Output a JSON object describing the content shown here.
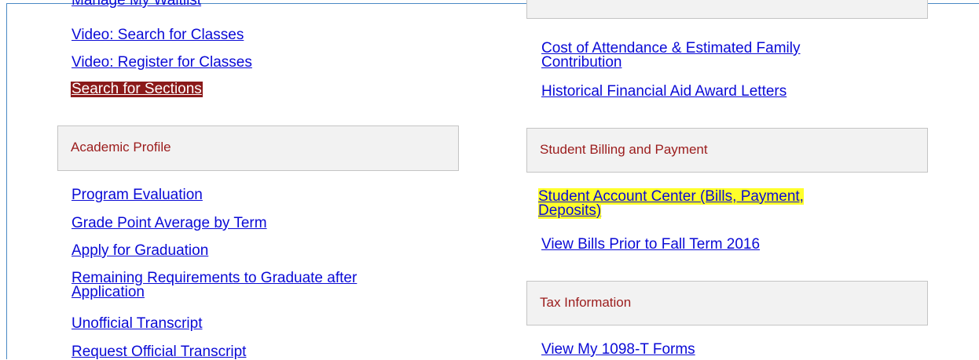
{
  "left": {
    "partial_link": "Manage My Waitlist",
    "links_top": [
      "Video: Search for Classes",
      "Video: Register for Classes",
      "Search for Sections"
    ],
    "panel_title": "Academic Profile",
    "links_bottom": [
      "Program Evaluation",
      "Grade Point Average by Term",
      "Apply for Graduation",
      "Remaining Requirements to Graduate after Application",
      "Unofficial Transcript",
      "Request Official Transcript"
    ]
  },
  "right": {
    "links_top": [
      "Cost of Attendance & Estimated Family Contribution",
      "Historical Financial Aid Award Letters"
    ],
    "billing_panel_title": "Student Billing and Payment",
    "billing_links": [
      "Student Account Center (Bills, Payment, Deposits)",
      "View Bills Prior to Fall Term 2016"
    ],
    "tax_panel_title": "Tax Information",
    "tax_links": [
      "View My 1098-T Forms"
    ]
  },
  "colors": {
    "link": "#0a0ad6",
    "selected_bg": "#8b1a1a",
    "panel_title": "#9b1c1c",
    "highlight": "#ffff2b",
    "frame": "#4a89c5"
  }
}
